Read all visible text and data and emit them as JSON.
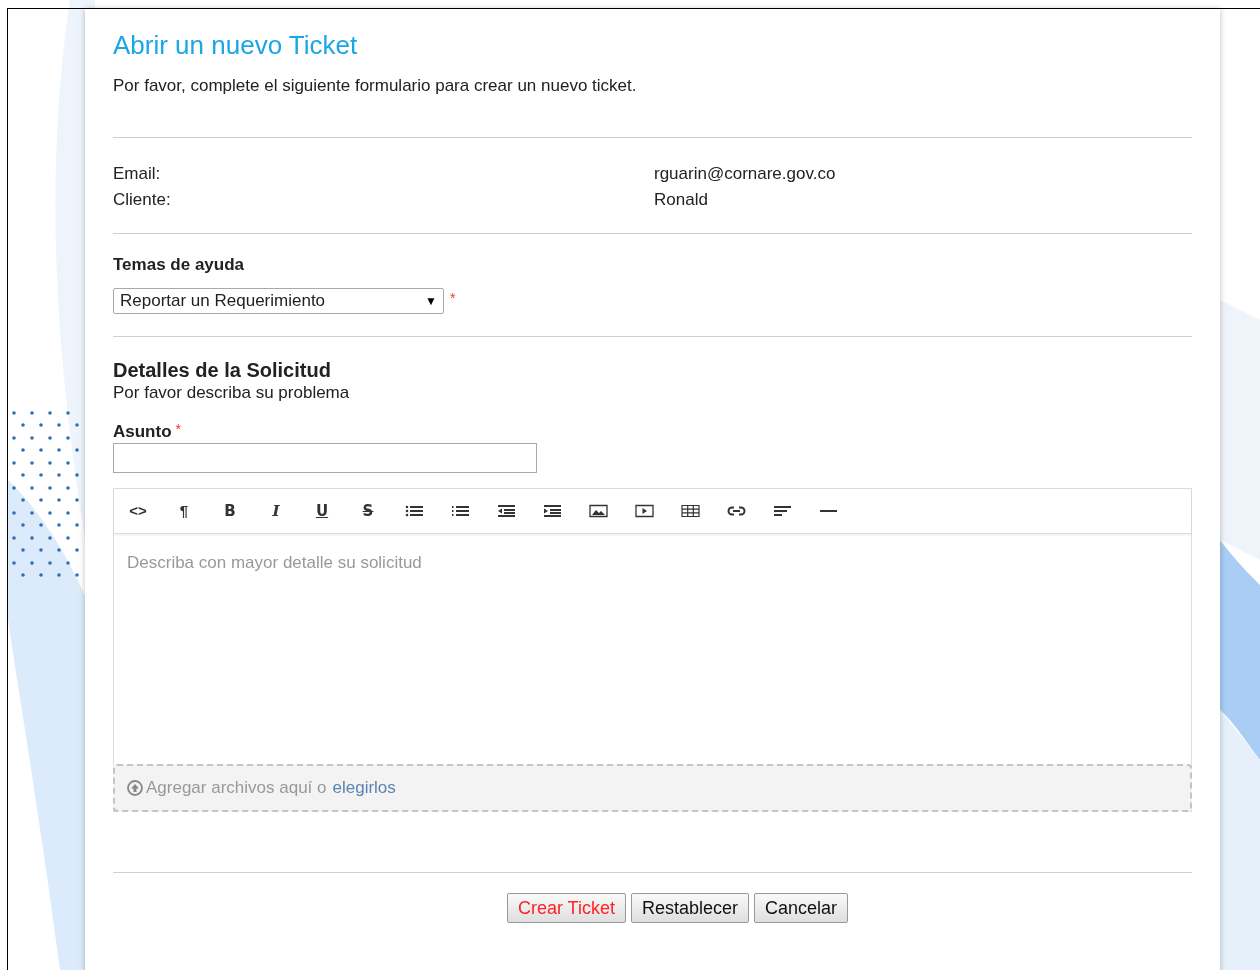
{
  "title": "Abrir un nuevo Ticket",
  "intro": "Por favor, complete el siguiente formulario para crear un nuevo ticket.",
  "user_info": [
    {
      "label": "Email:",
      "value": "rguarin@cornare.gov.co"
    },
    {
      "label": "Cliente:",
      "value": "Ronald"
    }
  ],
  "required_mark": "*",
  "help_topic": {
    "label": "Temas de ayuda",
    "value": "Reportar un Requerimiento",
    "caret": "▼",
    "required": true
  },
  "details": {
    "heading": "Detalles de la Solicitud",
    "subheading": "Por favor describa su problema"
  },
  "subject": {
    "label": "Asunto",
    "required": true
  },
  "editor": {
    "toolbar": [
      {
        "kind": "glyph",
        "text": "<>"
      },
      {
        "kind": "glyph",
        "text": "¶"
      },
      {
        "kind": "bold",
        "text": "B"
      },
      {
        "kind": "italic",
        "text": "I"
      },
      {
        "kind": "underline",
        "text": "U"
      },
      {
        "kind": "strike",
        "text": "S"
      },
      {
        "kind": "bullets"
      },
      {
        "kind": "numbers"
      },
      {
        "kind": "outdent"
      },
      {
        "kind": "indent"
      },
      {
        "kind": "image"
      },
      {
        "kind": "video"
      },
      {
        "kind": "table"
      },
      {
        "kind": "link"
      },
      {
        "kind": "align"
      },
      {
        "kind": "rule"
      }
    ],
    "placeholder": "Describa con mayor detalle su solicitud"
  },
  "attachments": {
    "text": "Agregar archivos aquí o",
    "link": "elegirlos"
  },
  "buttons": [
    {
      "label": "Crear Ticket",
      "kind": "primary"
    },
    {
      "label": "Restablecer",
      "kind": "normal"
    },
    {
      "label": "Cancelar",
      "kind": "normal"
    }
  ]
}
